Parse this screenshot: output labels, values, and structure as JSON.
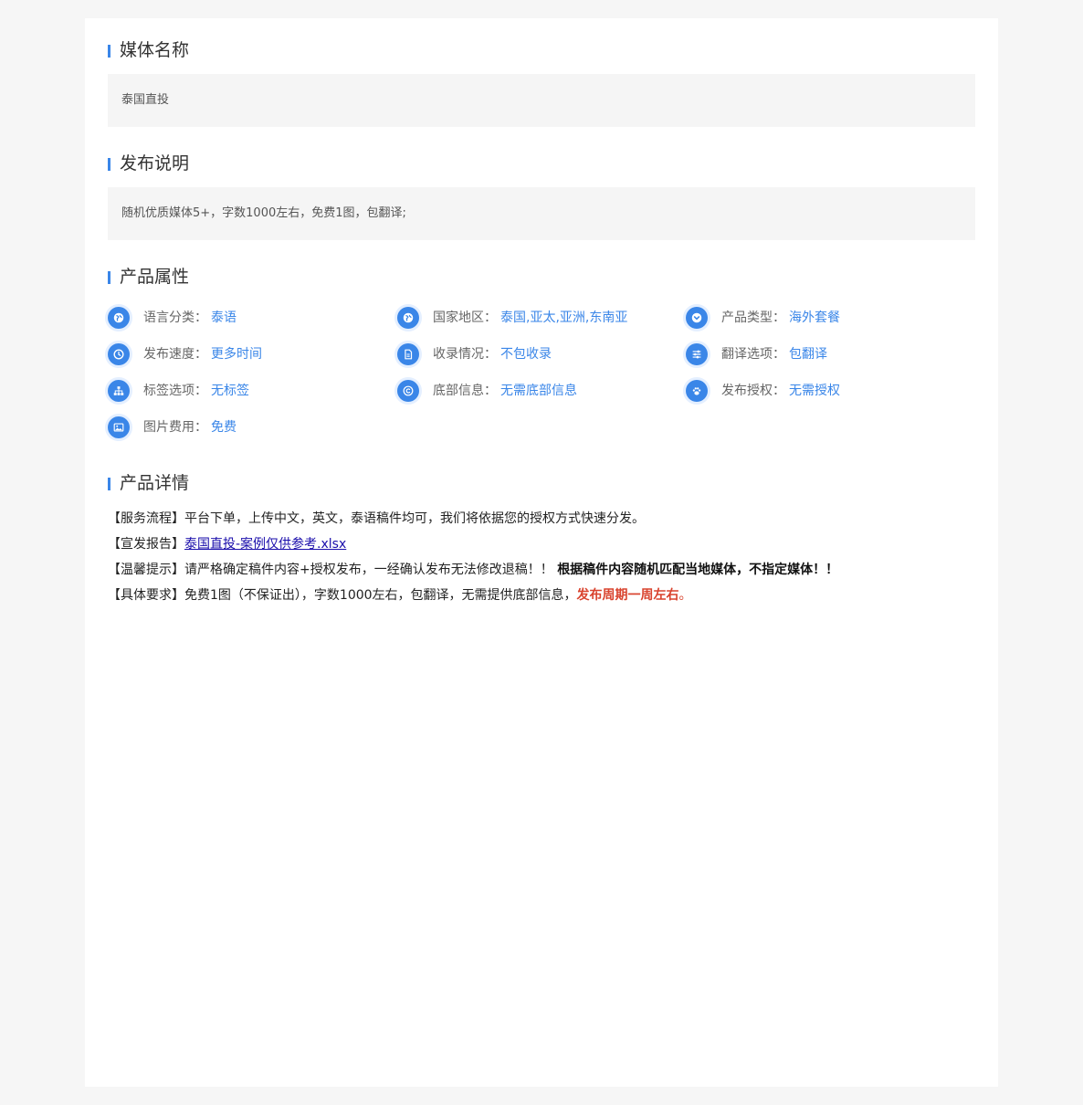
{
  "sections": {
    "media_name": {
      "title": "媒体名称",
      "value": "泰国直投"
    },
    "publish_note": {
      "title": "发布说明",
      "value": "随机优质媒体5+，字数1000左右，免费1图，包翻译;"
    },
    "attributes": {
      "title": "产品属性",
      "items": [
        {
          "icon": "globe-icon",
          "label": "语言分类：",
          "value": "泰语"
        },
        {
          "icon": "globe-icon",
          "label": "国家地区：",
          "value": "泰国,亚太,亚洲,东南亚"
        },
        {
          "icon": "chevron-down-circle-icon",
          "label": "产品类型：",
          "value": "海外套餐"
        },
        {
          "icon": "clock-icon",
          "label": "发布速度：",
          "value": "更多时间"
        },
        {
          "icon": "document-icon",
          "label": "收录情况：",
          "value": "不包收录"
        },
        {
          "icon": "sliders-icon",
          "label": "翻译选项：",
          "value": "包翻译"
        },
        {
          "icon": "sitemap-icon",
          "label": "标签选项：",
          "value": "无标签"
        },
        {
          "icon": "copyright-icon",
          "label": "底部信息：",
          "value": "无需底部信息"
        },
        {
          "icon": "paw-icon",
          "label": "发布授权：",
          "value": "无需授权"
        },
        {
          "icon": "image-icon",
          "label": "图片费用：",
          "value": "免费"
        }
      ]
    },
    "details": {
      "title": "产品详情",
      "service_flow": {
        "prefix": "【服务流程】",
        "text": "平台下单，上传中文，英文，泰语稿件均可，我们将依据您的授权方式快速分发。"
      },
      "report": {
        "prefix": "【宣发报告】",
        "link": "泰国直投-案例仅供参考.xlsx"
      },
      "warning": {
        "prefix": "【温馨提示】",
        "text": "请严格确定稿件内容+授权发布，一经确认发布无法修改退稿！！",
        "bold": "根据稿件内容随机匹配当地媒体，不指定媒体！！"
      },
      "requirements": {
        "prefix": "【具体要求】",
        "text": "免费1图（不保证出），字数1000左右，包翻译，无需提供底部信息，",
        "highlight": "发布周期一周左右",
        "suffix": "。"
      }
    }
  },
  "colors": {
    "accent": "#3a86e8",
    "highlight_red": "#d9432e",
    "link": "#1a0dab"
  }
}
